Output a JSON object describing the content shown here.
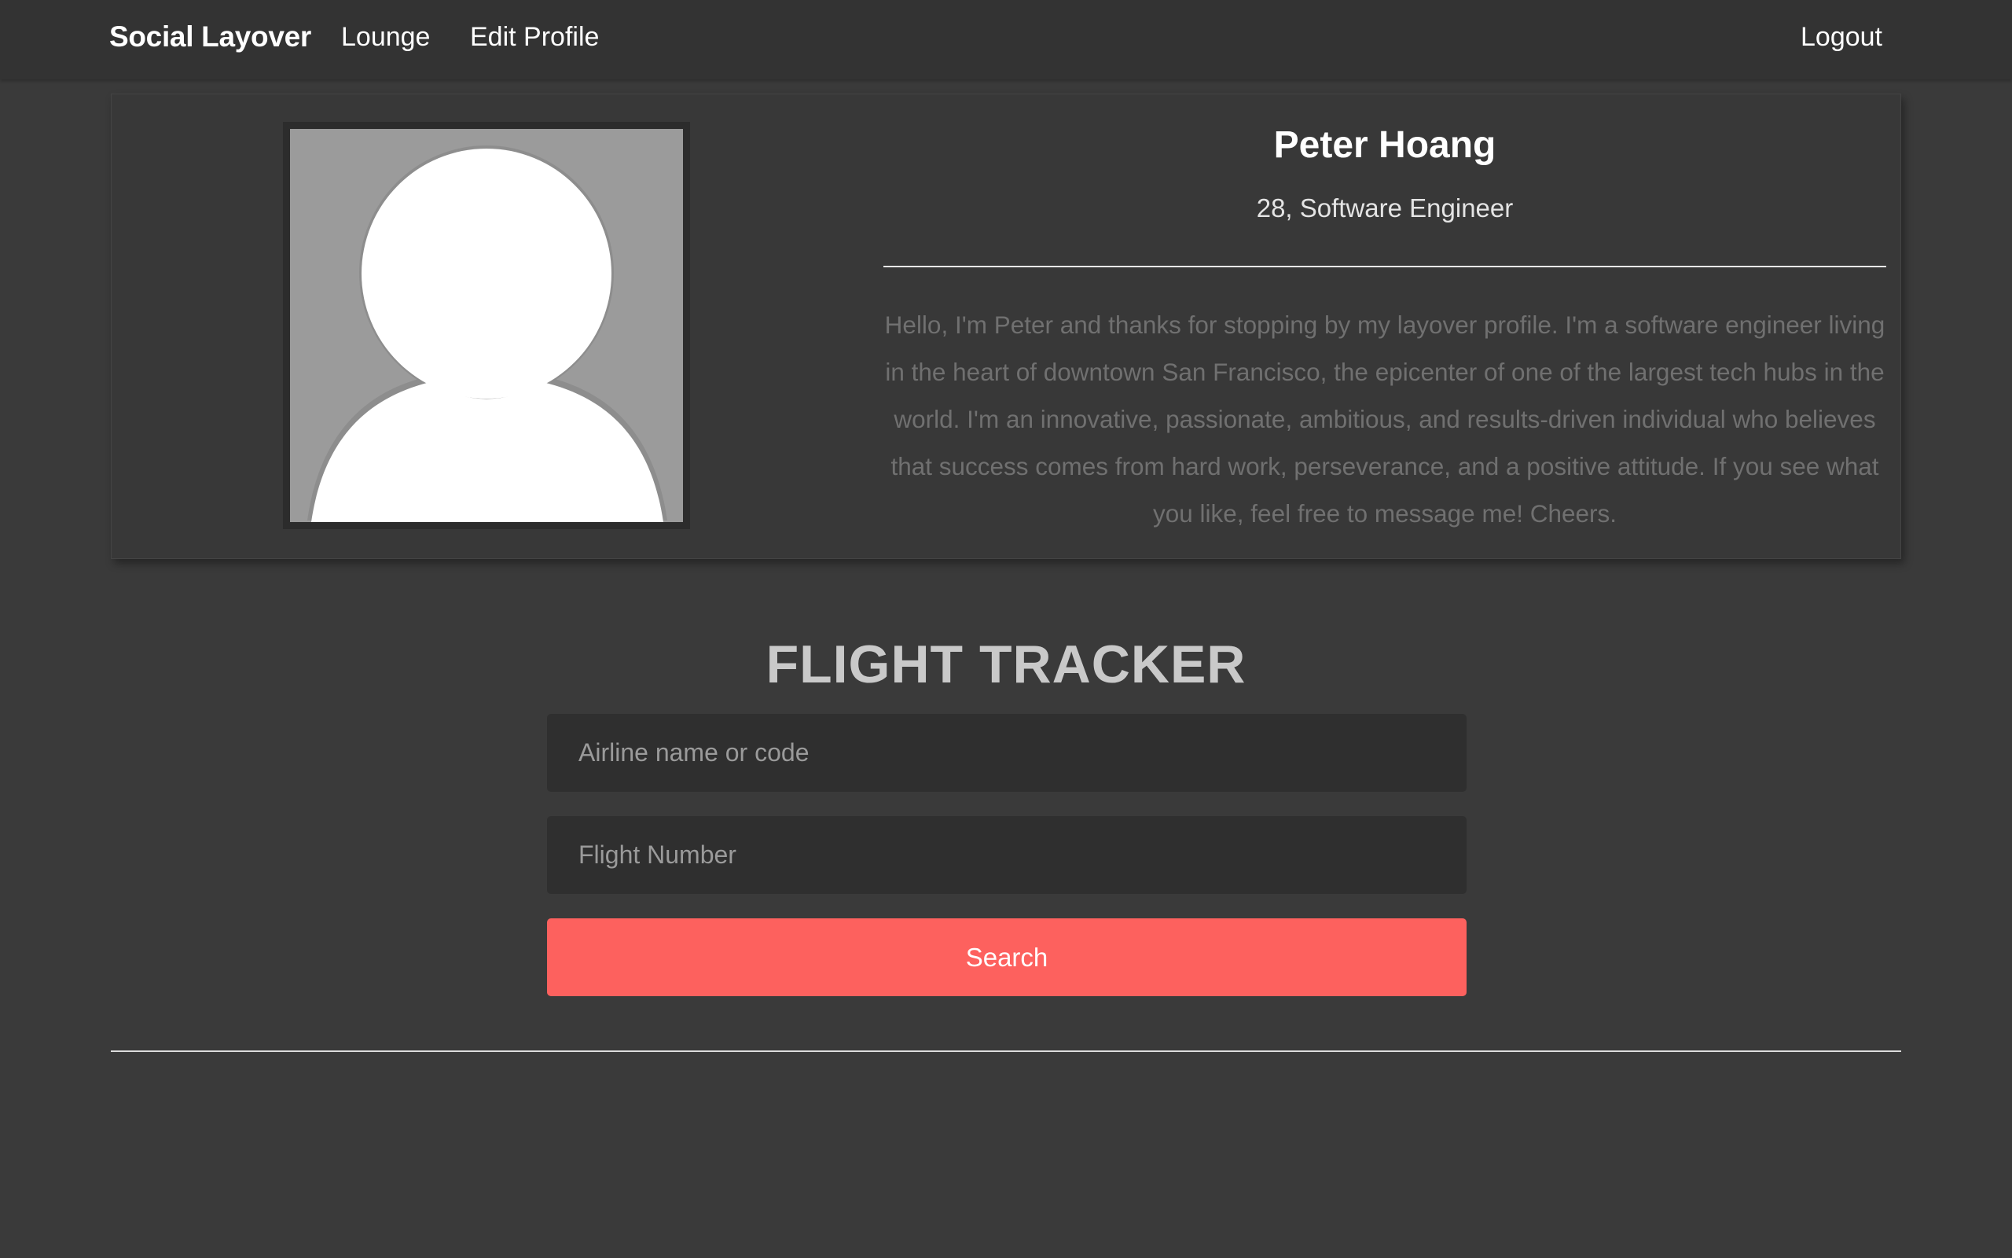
{
  "navbar": {
    "brand": "Social Layover",
    "links": {
      "lounge": "Lounge",
      "edit_profile": "Edit Profile",
      "logout": "Logout"
    }
  },
  "profile": {
    "avatar_icon": "default-user-avatar-icon",
    "name": "Peter Hoang",
    "subtitle": "28, Software Engineer",
    "bio": "Hello, I'm Peter and thanks for stopping by my layover profile. I'm a software engineer living in the heart of downtown San Francisco, the epicenter of one of the largest tech hubs in the world. I'm an innovative, passionate, ambitious, and results-driven individual who believes that success comes from hard work, perseverance, and a positive attitude. If you see what you like, feel free to message me! Cheers."
  },
  "tracker": {
    "title": "FLIGHT TRACKER",
    "airline_placeholder": "Airline name or code",
    "airline_value": "",
    "flight_placeholder": "Flight Number",
    "flight_value": "",
    "search_label": "Search"
  },
  "colors": {
    "background": "#3a3a3a",
    "navbar": "#333333",
    "accent": "#fd615e",
    "input_bg": "#2f2f2f"
  }
}
